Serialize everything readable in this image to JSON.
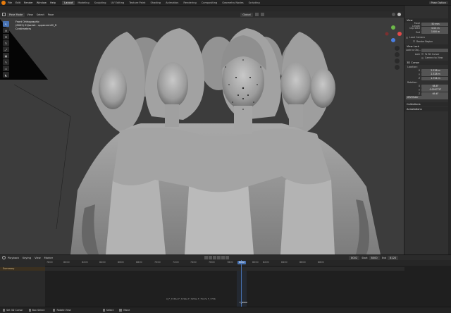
{
  "topbar": {
    "menus": [
      "File",
      "Edit",
      "Render",
      "Window",
      "Help"
    ],
    "tabs": [
      "Layout",
      "Modeling",
      "Sculpting",
      "UV Editing",
      "Texture Paint",
      "Shading",
      "Animation",
      "Rendering",
      "Compositing",
      "Geometry Nodes",
      "Scripting"
    ],
    "active_tab": "Layout",
    "scene_label": "Pose Option"
  },
  "viewport_header": {
    "mode": "Pose Mode",
    "menus": [
      "View",
      "Select",
      "Pose"
    ],
    "transform_orientation": "Global"
  },
  "viewport_info": {
    "line1": "Front Orthographic",
    "line2": "(8002) 01Jacket : upperarm02_R",
    "line3": "Centimeters"
  },
  "npanel": {
    "tabs": [
      "Item",
      "Tool",
      "View"
    ],
    "view_section": "View",
    "focal_length_label": "Focal Length",
    "focal_length": "50 mm",
    "clip_start_label": "Clip Start",
    "clip_start": "0.01 m",
    "clip_end_label": "End",
    "clip_end": "1000 m",
    "local_camera_label": "Local Camera",
    "render_region_label": "Render Region",
    "view_lock_section": "View Lock",
    "lock_to_object_label": "Lock to Obj...",
    "lock_label": "Lock",
    "lock_to_3d_cursor": "To 3D Cursor",
    "camera_to_view": "Camera to View",
    "cursor_section": "3D Cursor",
    "location_label": "Location:",
    "loc_x_label": "X",
    "loc_x": "2.228 m",
    "loc_y_label": "Y",
    "loc_y": "2.328 m",
    "loc_z_label": "Z",
    "loc_z": "1.704 m",
    "rotation_label": "Rotation:",
    "rot_x_label": "X",
    "rot_x": "68.8°",
    "rot_y_label": "Y",
    "rot_y": "0.000779°",
    "rot_z_label": "Z",
    "rot_z": "69.6°",
    "rotation_mode": "XYZ Euler",
    "collections_section": "Collections",
    "annotations_section": "Annotations"
  },
  "timeline": {
    "menus": [
      "Playback",
      "Keying",
      "View",
      "Marker"
    ],
    "current_frame": "8002",
    "start_label": "Start",
    "start": "8000",
    "end_label": "End",
    "end": "8120",
    "summary_label": "Summary",
    "ruler": [
      "7800",
      "8000",
      "8200",
      "8400",
      "8600",
      "8800",
      "7000",
      "7200",
      "7400",
      "7600",
      "7800",
      "8000",
      "8200",
      "8400",
      "8600",
      "8800"
    ],
    "playhead_label": "8002",
    "marker_text": "0_F_7155A F_7156A F_7455A F_7547A F_7756",
    "marker_frame": "F_8000"
  },
  "statusbar": {
    "items": [
      "Set 3D Cursor",
      "Box Select",
      "Rotate View",
      "Select",
      "Move"
    ]
  },
  "colors": {
    "accent": "#4772b3",
    "viewport_bg": "#3c3c3c",
    "model_gray": "#9a9a9a",
    "playhead": "#4772b3"
  }
}
